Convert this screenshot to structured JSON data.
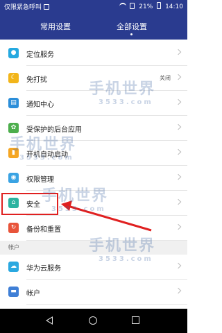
{
  "status_bar": {
    "carrier": "仅限紧急呼叫",
    "battery": "21%",
    "time": "14:10"
  },
  "tabs": [
    "常用设置",
    "全部设置"
  ],
  "settings": [
    {
      "label": "定位服务",
      "icon": "location-icon",
      "color": "#25a9e0"
    },
    {
      "label": "免打扰",
      "icon": "moon-icon",
      "color": "#f2b51a",
      "value": "关闭"
    },
    {
      "label": "通知中心",
      "icon": "notification-icon",
      "color": "#2b8ed9"
    },
    {
      "label": "受保护的后台应用",
      "icon": "protected-apps-icon",
      "color": "#4cae4c"
    },
    {
      "label": "开机自动启动",
      "icon": "autostart-icon",
      "color": "#f5a623"
    },
    {
      "label": "权限管理",
      "icon": "permission-icon",
      "color": "#3aa3e3"
    },
    {
      "label": "安全",
      "icon": "security-icon",
      "color": "#2bb3a0"
    },
    {
      "label": "备份和重置",
      "icon": "backup-icon",
      "color": "#e8543a"
    }
  ],
  "section_accounts": "帐户",
  "accounts": [
    {
      "label": "华为云服务",
      "icon": "cloud-icon",
      "color": "#2aa8e0"
    },
    {
      "label": "帐户",
      "icon": "account-icon",
      "color": "#3f7fd6"
    }
  ],
  "watermark": {
    "text": "手机世界",
    "sub": "3533.com"
  },
  "colors": {
    "header": "#2a3b8f",
    "highlight": "#e02020"
  }
}
